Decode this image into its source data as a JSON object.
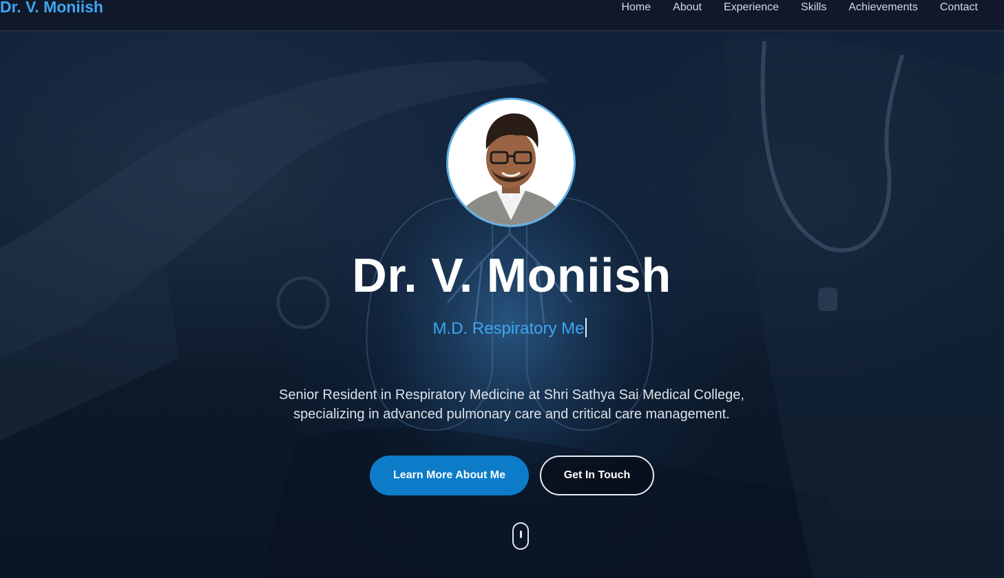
{
  "nav": {
    "brand": "Dr. V. Moniish",
    "links": [
      "Home",
      "About",
      "Experience",
      "Skills",
      "Achievements",
      "Contact"
    ]
  },
  "hero": {
    "title": "Dr. V. Moniish",
    "subtitle_typed": "M.D. Respiratory Me",
    "description": "Senior Resident in Respiratory Medicine at Shri Sathya Sai Medical College, specializing in advanced pulmonary care and critical care management.",
    "primary_button": "Learn More About Me",
    "secondary_button": "Get In Touch"
  },
  "colors": {
    "accent": "#3ea6f0",
    "primary_button": "#0c7cc9",
    "background": "#0e1c2f"
  },
  "icons": {
    "profile_photo": "profile-photo",
    "scroll": "mouse-scroll-icon"
  }
}
